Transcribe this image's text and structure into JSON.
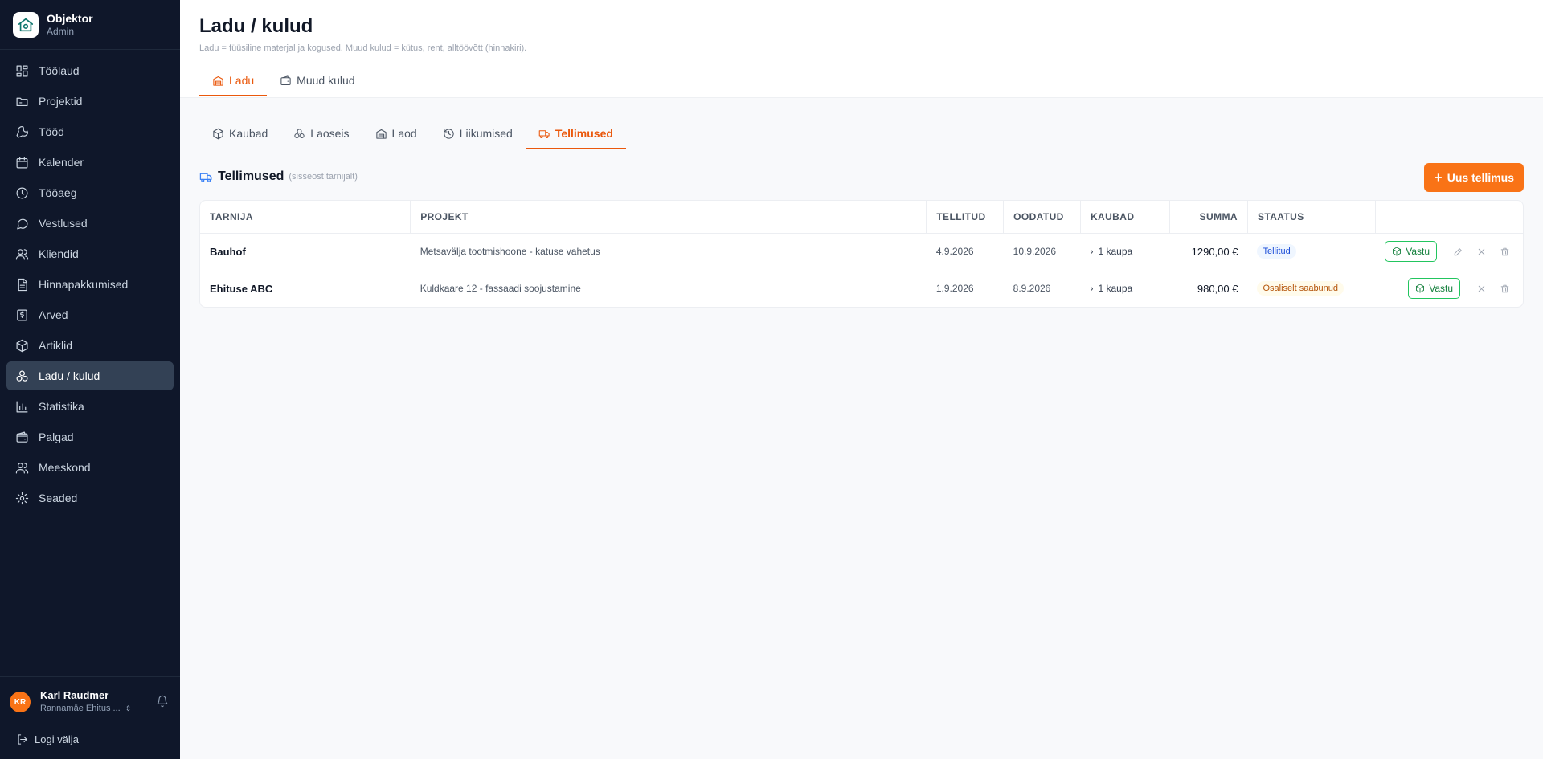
{
  "brand": {
    "name": "Objektor",
    "role": "Admin"
  },
  "sidebar": {
    "items": [
      {
        "label": "Töölaud",
        "icon": "dashboard-icon"
      },
      {
        "label": "Projektid",
        "icon": "folder-icon"
      },
      {
        "label": "Tööd",
        "icon": "wrench-icon"
      },
      {
        "label": "Kalender",
        "icon": "calendar-icon"
      },
      {
        "label": "Tööaeg",
        "icon": "clock-icon"
      },
      {
        "label": "Vestlused",
        "icon": "chat-icon"
      },
      {
        "label": "Kliendid",
        "icon": "users-icon"
      },
      {
        "label": "Hinnapakkumised",
        "icon": "document-icon"
      },
      {
        "label": "Arved",
        "icon": "invoice-icon"
      },
      {
        "label": "Artiklid",
        "icon": "box-icon"
      },
      {
        "label": "Ladu / kulud",
        "icon": "boxes-icon",
        "active": true
      },
      {
        "label": "Statistika",
        "icon": "bar-chart-icon"
      },
      {
        "label": "Palgad",
        "icon": "wallet-icon"
      },
      {
        "label": "Meeskond",
        "icon": "team-icon"
      },
      {
        "label": "Seaded",
        "icon": "gear-icon"
      }
    ]
  },
  "user": {
    "initials": "KR",
    "name": "Karl Raudmer",
    "company": "Rannamäe Ehitus ..."
  },
  "logout_label": "Logi välja",
  "page": {
    "title": "Ladu / kulud",
    "subtitle": "Ladu = füüsiline materjal ja kogused. Muud kulud = kütus, rent, alltöövõtt (hinnakiri).",
    "top_tabs": [
      {
        "label": "Ladu",
        "active": true
      },
      {
        "label": "Muud kulud"
      }
    ],
    "sub_tabs": [
      {
        "label": "Kaubad"
      },
      {
        "label": "Laoseis"
      },
      {
        "label": "Laod"
      },
      {
        "label": "Liikumised"
      },
      {
        "label": "Tellimused",
        "active": true
      }
    ]
  },
  "orders": {
    "title": "Tellimused",
    "note": "(sisseost tarnijalt)",
    "new_button": "Uus tellimus",
    "columns": {
      "supplier": "TARNIJA",
      "project": "PROJEKT",
      "ordered": "TELLITUD",
      "expected": "OODATUD",
      "items": "KAUBAD",
      "sum": "SUMMA",
      "status": "STAATUS"
    },
    "receive_label": "Vastu",
    "rows": [
      {
        "supplier": "Bauhof",
        "project": "Metsavälja tootmishoone - katuse vahetus",
        "ordered": "4.9.2026",
        "expected": "10.9.2026",
        "items": "1 kaupa",
        "sum": "1290,00 €",
        "status": "Tellitud"
      },
      {
        "supplier": "Ehituse ABC",
        "project": "Kuldkaare 12 - fassaadi soojustamine",
        "ordered": "1.9.2026",
        "expected": "8.9.2026",
        "items": "1 kaupa",
        "sum": "980,00 €",
        "status": "Osaliselt saabunud"
      }
    ]
  },
  "colors": {
    "accent": "#f97316",
    "sidebar_bg": "#0f172a",
    "status_ordered": "#1d4ed8",
    "status_partial": "#b45309",
    "receive_green": "#15803d"
  }
}
